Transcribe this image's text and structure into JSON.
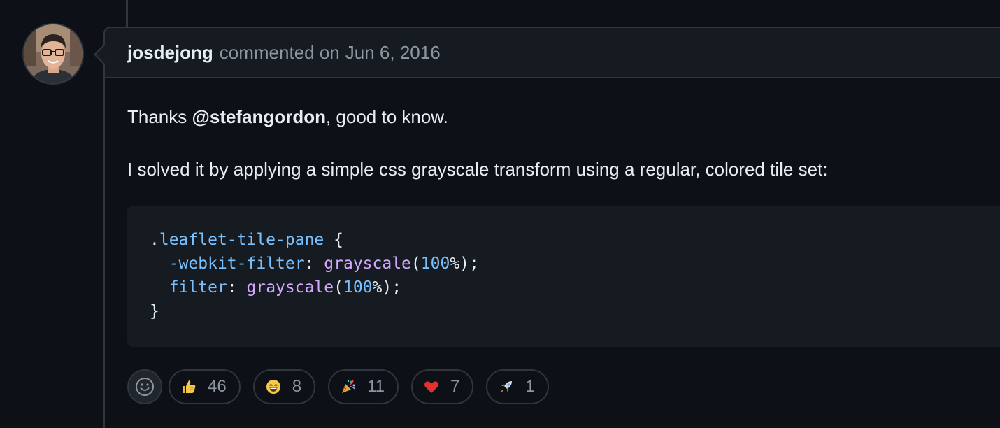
{
  "comment": {
    "author": "josdejong",
    "action": "commented on",
    "date": "Jun 6, 2016",
    "body": {
      "para1_prefix": "Thanks ",
      "mention": "@stefangordon",
      "para1_suffix": ", good to know.",
      "para2": "I solved it by applying a simple css grayscale transform using a regular, colored tile set:"
    },
    "code": {
      "language": "css",
      "line1": {
        "dot": ".",
        "selector": "leaflet-tile-pane",
        "brace": " {"
      },
      "line2": {
        "indent": "  ",
        "prop": "-webkit-filter",
        "colon": ": ",
        "fn": "grayscale",
        "open": "(",
        "num": "100",
        "pct": "%",
        "close": ");"
      },
      "line3": {
        "indent": "  ",
        "prop": "filter",
        "colon": ": ",
        "fn": "grayscale",
        "open": "(",
        "num": "100",
        "pct": "%",
        "close": ");"
      },
      "line4": {
        "brace": "}"
      }
    }
  },
  "reactions": [
    {
      "icon": "thumbs-up-icon",
      "count": "46"
    },
    {
      "icon": "laugh-icon",
      "count": "8"
    },
    {
      "icon": "hooray-icon",
      "count": "11"
    },
    {
      "icon": "heart-icon",
      "count": "7"
    },
    {
      "icon": "rocket-icon",
      "count": "1"
    }
  ],
  "colors": {
    "background": "#0d1117",
    "header_bg": "#161b22",
    "border": "#30363d",
    "muted_text": "#8d96a0",
    "code_blue": "#79c0ff",
    "code_purple": "#d2a8ff"
  }
}
